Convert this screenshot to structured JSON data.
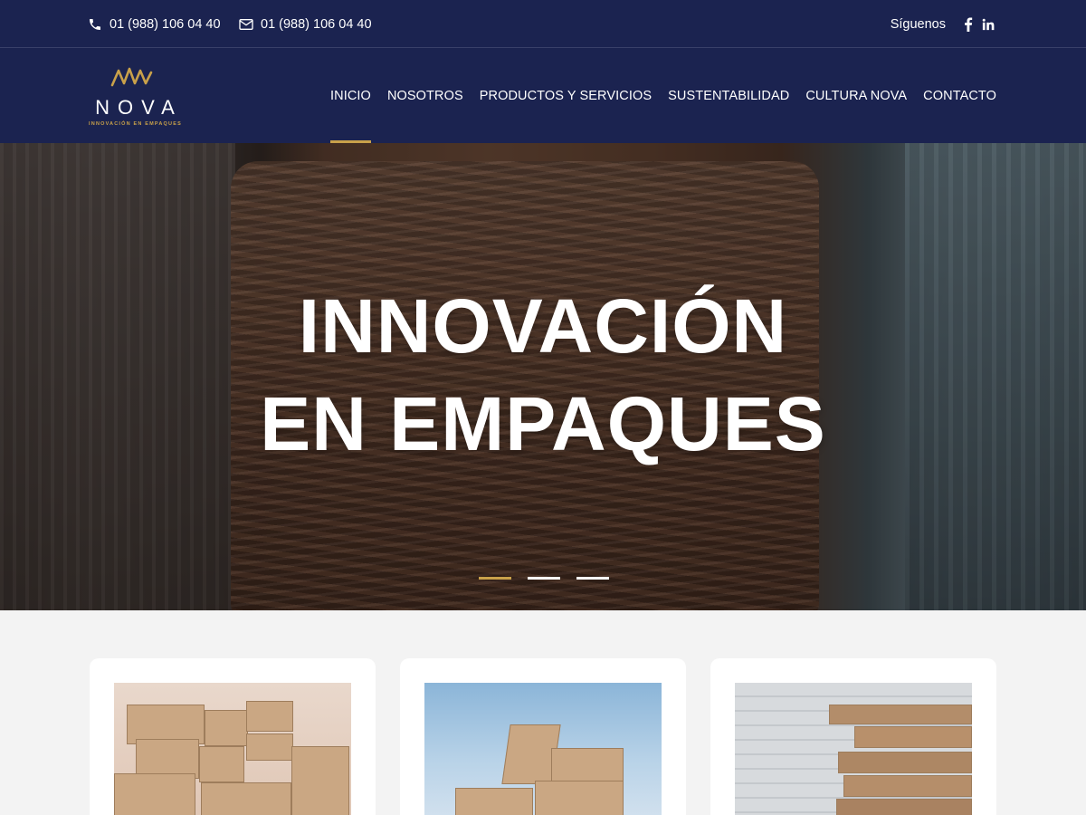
{
  "topbar": {
    "phone": "01 (988) 106 04 40",
    "email": "01 (988) 106 04 40",
    "follow_label": "Síguenos",
    "social_icons": [
      "facebook-icon",
      "linkedin-icon"
    ]
  },
  "brand": {
    "name": "NOVA",
    "tagline": "INNOVACIÓN EN EMPAQUES",
    "accent_color": "#c9a14a",
    "header_color": "#1b2350"
  },
  "nav": {
    "items": [
      {
        "label": "INICIO",
        "active": true
      },
      {
        "label": "NOSOTROS"
      },
      {
        "label": "PRODUCTOS Y SERVICIOS"
      },
      {
        "label": "SUSTENTABILIDAD"
      },
      {
        "label": "CULTURA NOVA"
      },
      {
        "label": "CONTACTO"
      }
    ]
  },
  "hero": {
    "line1": "INNOVACIÓN",
    "line2": "EN EMPAQUES",
    "slides": 3,
    "active_slide": 1
  }
}
